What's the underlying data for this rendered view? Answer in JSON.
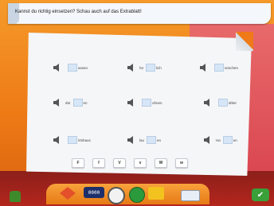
{
  "instruction": "Kannst du richtig einsetzen? Schau auch auf das Extrablatt!",
  "rows": [
    [
      {
        "pre": "",
        "post": "assen"
      },
      {
        "pre": "hö",
        "post": "lich"
      },
      {
        "pre": "",
        "post": "ünschen"
      }
    ],
    [
      {
        "pre": "dür",
        "post": "en"
      },
      {
        "pre": "",
        "post": "ohnen"
      },
      {
        "pre": "",
        "post": "ähler"
      }
    ],
    [
      {
        "pre": "",
        "post": "irtshaus"
      },
      {
        "pre": "lau",
        "post": "en"
      },
      {
        "pre": "Ha",
        "post": "en"
      }
    ]
  ],
  "letters": [
    "F",
    "f",
    "V",
    "v",
    "W",
    "w"
  ],
  "toolbar": {
    "counter_text": "0000"
  }
}
